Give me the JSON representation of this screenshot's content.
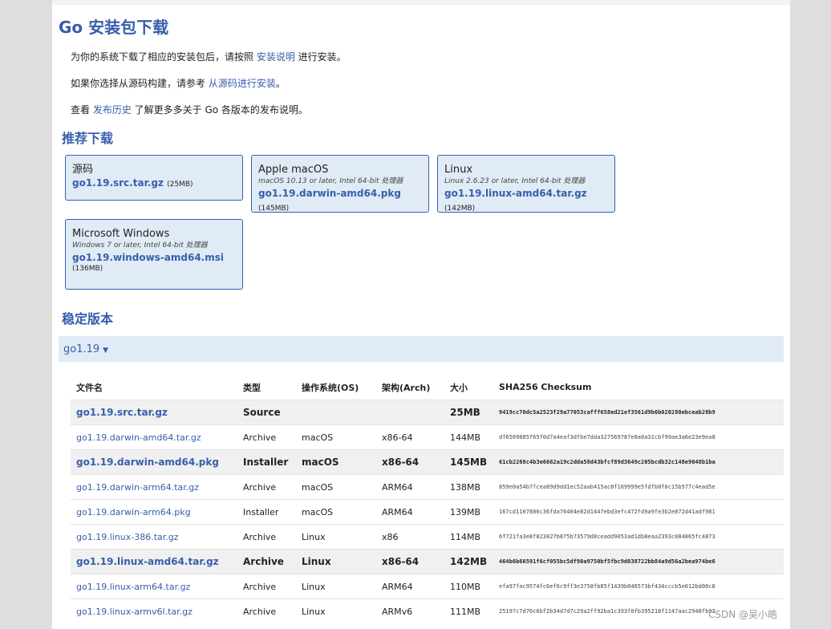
{
  "header": {
    "title": "Go 安装包下载"
  },
  "intro": [
    {
      "before": "为你的系统下载了相应的安装包后，请按照 ",
      "link": "安装说明",
      "after": " 进行安装。"
    },
    {
      "before": "如果你选择从源码构建，请参考 ",
      "link": "从源码进行安装",
      "after": "。"
    },
    {
      "before": "查看 ",
      "link": "发布历史",
      "after": " 了解更多多关于 Go 各版本的发布说明。"
    }
  ],
  "featured": {
    "title": "推荐下载",
    "cards": [
      {
        "os": "源码",
        "req": "",
        "file": "go1.19.src.tar.gz",
        "size": "(25MB)"
      },
      {
        "os": "Apple macOS",
        "req": "macOS 10.13 or later, Intel 64-bit 处理器",
        "file": "go1.19.darwin-amd64.pkg",
        "size": "(145MB)"
      },
      {
        "os": "Linux",
        "req": "Linux 2.6.23 or later, Intel 64-bit 处理器",
        "file": "go1.19.linux-amd64.tar.gz",
        "size": "(142MB)"
      },
      {
        "os": "Microsoft Windows",
        "req": "Windows 7 or later, Intel 64-bit 处理器",
        "file": "go1.19.windows-amd64.msi",
        "size": "(136MB)"
      }
    ]
  },
  "stable": {
    "title": "稳定版本",
    "version": "go1.19",
    "arrow": "▼",
    "headers": [
      "文件名",
      "类型",
      "操作系统(OS)",
      "架构(Arch)",
      "大小",
      "SHA256 Checksum"
    ],
    "rows": [
      {
        "file": "go1.19.src.tar.gz",
        "kind": "Source",
        "os": "",
        "arch": "",
        "size": "25MB",
        "sha": "9419cc70dc5a2523f29a77053cafff658ed21ef3561d9b6b020280ebceab28b9",
        "highlight": true
      },
      {
        "file": "go1.19.darwin-amd64.tar.gz",
        "kind": "Archive",
        "os": "macOS",
        "arch": "x86-64",
        "size": "144MB",
        "sha": "df6509885f65f0d7a4eaf3dfbe7dda327569787e8a0a31cbf99ae3a6e23e9ea8",
        "highlight": false
      },
      {
        "file": "go1.19.darwin-amd64.pkg",
        "kind": "Installer",
        "os": "macOS",
        "arch": "x86-64",
        "size": "145MB",
        "sha": "61cb2268c4b3e6662a19c2dda58d43bfcf89d3649c205bcdb32c148e9048b1ba",
        "highlight": true
      },
      {
        "file": "go1.19.darwin-arm64.tar.gz",
        "kind": "Archive",
        "os": "macOS",
        "arch": "ARM64",
        "size": "138MB",
        "sha": "859e0a54b7fcea89d9dd1ec52aab415ac8f169999e5fdfb0f0c15b577c4ead5e",
        "highlight": false
      },
      {
        "file": "go1.19.darwin-arm64.pkg",
        "kind": "Installer",
        "os": "macOS",
        "arch": "ARM64",
        "size": "139MB",
        "sha": "167cd1107886c36fda76404e82d1447ebd3efc472fd9a9fe3b2e872d41adf981",
        "highlight": false
      },
      {
        "file": "go1.19.linux-386.tar.gz",
        "kind": "Archive",
        "os": "Linux",
        "arch": "x86",
        "size": "114MB",
        "sha": "6f721fa3e8f823827b875b73579d8ceadd9053ad1db8eaa2393c084865fc4873",
        "highlight": false
      },
      {
        "file": "go1.19.linux-amd64.tar.gz",
        "kind": "Archive",
        "os": "Linux",
        "arch": "x86-64",
        "size": "142MB",
        "sha": "464b6b66591f6cf055bc5df90a9750bf5fbc9d038722bb84a9d56a2bea974be6",
        "highlight": true
      },
      {
        "file": "go1.19.linux-arm64.tar.gz",
        "kind": "Archive",
        "os": "Linux",
        "arch": "ARM64",
        "size": "110MB",
        "sha": "efa97fac9574fc6ef6c9ff3e3758fb85f1439b046573bf434cccb5e012bd00c8",
        "highlight": false
      },
      {
        "file": "go1.19.linux-armv6l.tar.gz",
        "kind": "Archive",
        "os": "Linux",
        "arch": "ARMv6",
        "size": "111MB",
        "sha": "25197c7d70c6bf2b34d7d7c29a2ff92ba1c393f0fb395218f1147aac2948fb93",
        "highlight": false
      }
    ]
  },
  "watermark": "CSDN @吴小皓"
}
